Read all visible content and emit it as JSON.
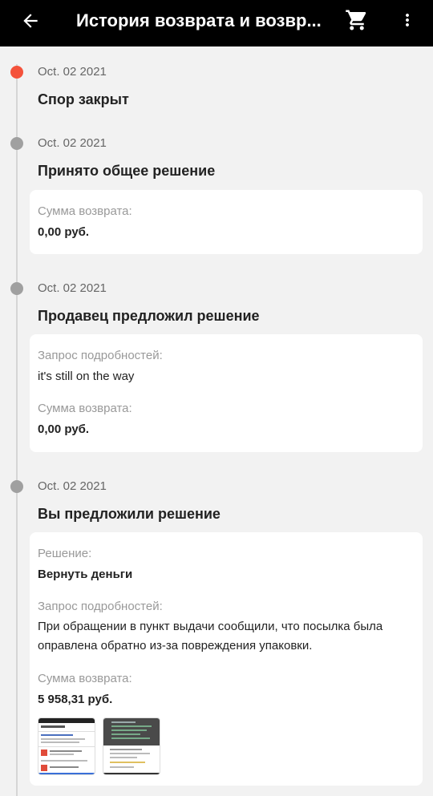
{
  "header": {
    "title": "История возврата и возвр...",
    "back_icon": "arrow-left-icon",
    "cart_icon": "cart-icon",
    "more_icon": "more-vert-icon"
  },
  "colors": {
    "active_dot": "#f4523b",
    "inactive_dot": "#a0a0a0",
    "appbar": "#000000"
  },
  "events": [
    {
      "date": "Oct. 02 2021",
      "status": "Спор закрыт"
    },
    {
      "date": "Oct. 02 2021",
      "status": "Принято общее решение",
      "refund_label": "Сумма возврата:",
      "refund_value": "0,00 руб."
    },
    {
      "date": "Oct. 02 2021",
      "status": "Продавец предложил решение",
      "details_label": "Запрос подробностей:",
      "details_value": "it's still on the way",
      "refund_label": "Сумма возврата:",
      "refund_value": "0,00 руб."
    },
    {
      "date": "Oct. 02 2021",
      "status": "Вы предложили решение",
      "solution_label": "Решение:",
      "solution_value": "Вернуть деньги",
      "details_label": "Запрос подробностей:",
      "details_value": "При обращении в пункт выдачи сообщили, что посылка была оправлена обратно из-за повреждения упаковки.",
      "refund_label": "Сумма возврата:",
      "refund_value": "5 958,31 руб."
    }
  ]
}
